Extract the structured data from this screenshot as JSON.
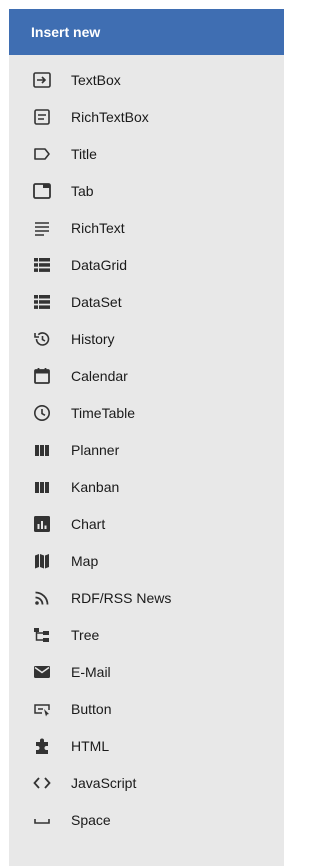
{
  "header": {
    "title": "Insert new"
  },
  "items": [
    {
      "label": "TextBox",
      "icon": "textbox-icon"
    },
    {
      "label": "RichTextBox",
      "icon": "richtextbox-icon"
    },
    {
      "label": "Title",
      "icon": "title-icon"
    },
    {
      "label": "Tab",
      "icon": "tab-icon"
    },
    {
      "label": "RichText",
      "icon": "richtext-icon"
    },
    {
      "label": "DataGrid",
      "icon": "datagrid-icon"
    },
    {
      "label": "DataSet",
      "icon": "dataset-icon"
    },
    {
      "label": "History",
      "icon": "history-icon"
    },
    {
      "label": "Calendar",
      "icon": "calendar-icon"
    },
    {
      "label": "TimeTable",
      "icon": "timetable-icon"
    },
    {
      "label": "Planner",
      "icon": "planner-icon"
    },
    {
      "label": "Kanban",
      "icon": "kanban-icon"
    },
    {
      "label": "Chart",
      "icon": "chart-icon"
    },
    {
      "label": "Map",
      "icon": "map-icon"
    },
    {
      "label": "RDF/RSS News",
      "icon": "rss-icon"
    },
    {
      "label": "Tree",
      "icon": "tree-icon"
    },
    {
      "label": "E-Mail",
      "icon": "email-icon"
    },
    {
      "label": "Button",
      "icon": "button-icon"
    },
    {
      "label": "HTML",
      "icon": "html-icon"
    },
    {
      "label": "JavaScript",
      "icon": "javascript-icon"
    },
    {
      "label": "Space",
      "icon": "space-icon"
    }
  ],
  "colors": {
    "header_bg": "#3f6eb2",
    "panel_bg": "#e8e8e8",
    "icon": "#333333"
  }
}
